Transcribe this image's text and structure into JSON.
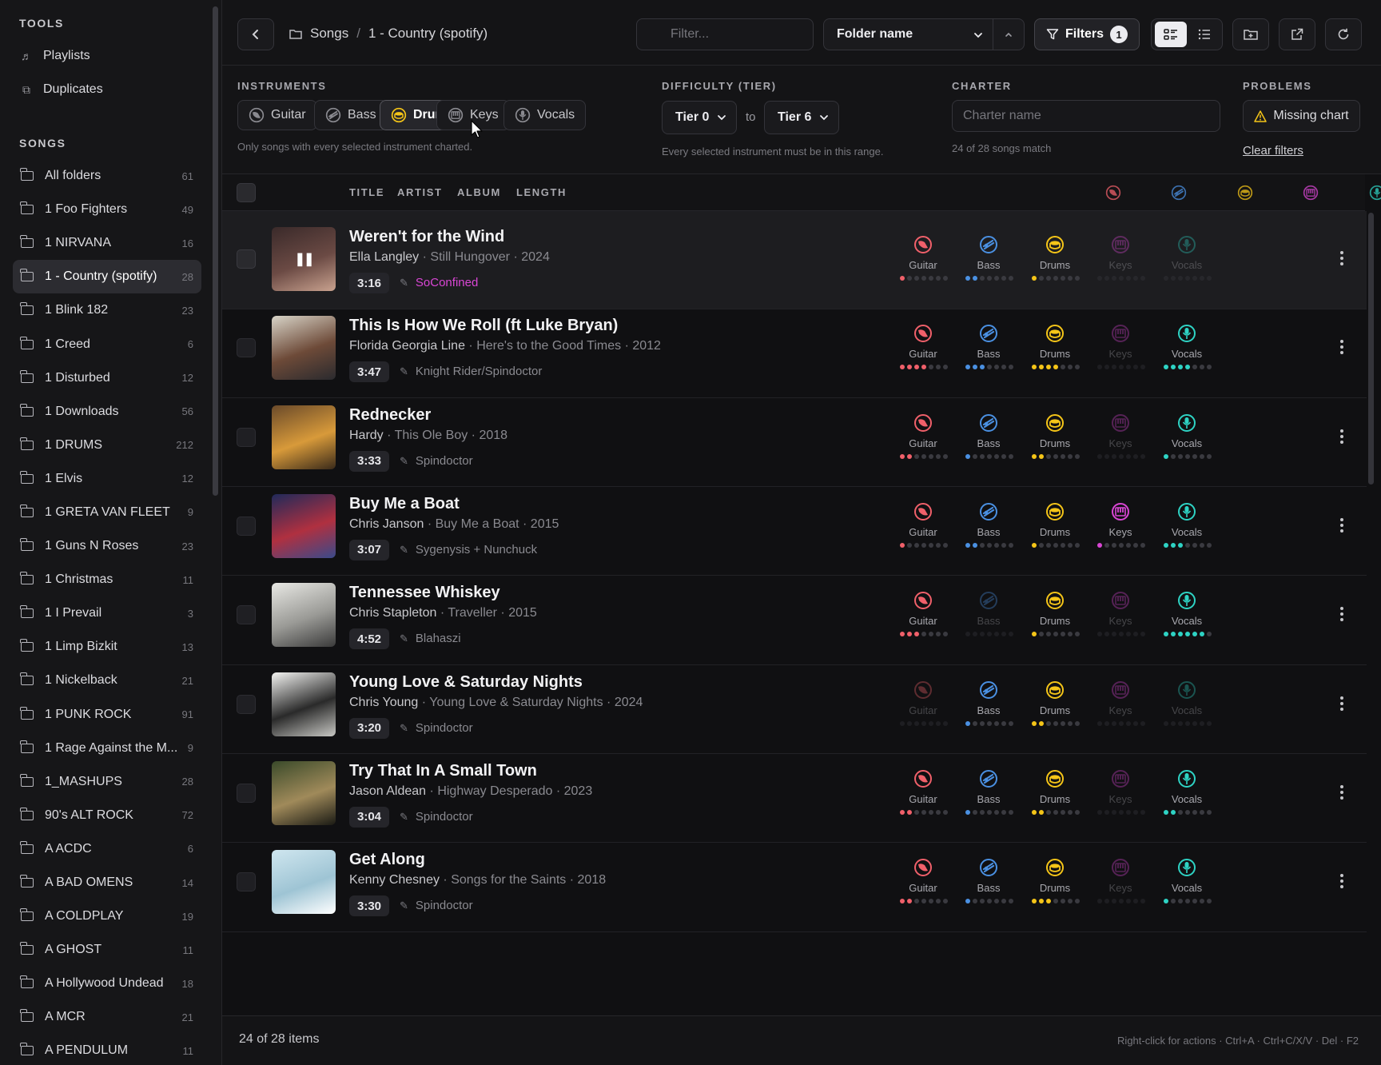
{
  "sidebar": {
    "tools_heading": "TOOLS",
    "tools": [
      {
        "label": "Playlists",
        "icon": "music-note-icon"
      },
      {
        "label": "Duplicates",
        "icon": "duplicate-icon"
      }
    ],
    "songs_heading": "SONGS",
    "folders": [
      {
        "name": "All folders",
        "count": "61"
      },
      {
        "name": "1 Foo Fighters",
        "count": "49"
      },
      {
        "name": "1 NIRVANA",
        "count": "16"
      },
      {
        "name": "1 - Country (spotify)",
        "count": "28",
        "active": true
      },
      {
        "name": "1 Blink 182",
        "count": "23"
      },
      {
        "name": "1 Creed",
        "count": "6"
      },
      {
        "name": "1 Disturbed",
        "count": "12"
      },
      {
        "name": "1 Downloads",
        "count": "56"
      },
      {
        "name": "1 DRUMS",
        "count": "212"
      },
      {
        "name": "1 Elvis",
        "count": "12"
      },
      {
        "name": "1 GRETA VAN FLEET",
        "count": "9"
      },
      {
        "name": "1 Guns N Roses",
        "count": "23"
      },
      {
        "name": "1 Christmas",
        "count": "11"
      },
      {
        "name": "1 I Prevail",
        "count": "3"
      },
      {
        "name": "1 Limp Bizkit",
        "count": "13"
      },
      {
        "name": "1 Nickelback",
        "count": "21"
      },
      {
        "name": "1 PUNK ROCK",
        "count": "91"
      },
      {
        "name": "1 Rage Against the M...",
        "count": "9"
      },
      {
        "name": "1_MASHUPS",
        "count": "28"
      },
      {
        "name": "90's ALT ROCK",
        "count": "72"
      },
      {
        "name": "A ACDC",
        "count": "6"
      },
      {
        "name": "A BAD OMENS",
        "count": "14"
      },
      {
        "name": "A COLDPLAY",
        "count": "19"
      },
      {
        "name": "A GHOST",
        "count": "11"
      },
      {
        "name": "A Hollywood Undead",
        "count": "18"
      },
      {
        "name": "A MCR",
        "count": "21"
      },
      {
        "name": "A PENDULUM",
        "count": "11"
      }
    ]
  },
  "toolbar": {
    "breadcrumb_root": "Songs",
    "breadcrumb_sep": "/",
    "breadcrumb_current": "1 - Country (spotify)",
    "filter_placeholder": "Filter...",
    "sort_label": "Folder name",
    "filters_label": "Filters",
    "filters_count": "1"
  },
  "filters": {
    "instruments_heading": "INSTRUMENTS",
    "instruments": [
      {
        "label": "Guitar",
        "selected": false
      },
      {
        "label": "Bass",
        "selected": false
      },
      {
        "label": "Drums",
        "selected": true
      },
      {
        "label": "Keys",
        "selected": false
      },
      {
        "label": "Vocals",
        "selected": false
      }
    ],
    "instruments_note": "Only songs with every selected instrument charted.",
    "difficulty_heading": "DIFFICULTY (TIER)",
    "tier_from": "Tier 0",
    "tier_to_word": "to",
    "tier_to": "Tier 6",
    "difficulty_note": "Every selected instrument must be in this range.",
    "charter_heading": "CHARTER",
    "charter_placeholder": "Charter name",
    "charter_note": "24 of 28 songs match",
    "problems_heading": "PROBLEMS",
    "missing_chart_label": "Missing chart",
    "clear_filters_label": "Clear filters"
  },
  "columns": {
    "title": "TITLE",
    "artist": "ARTIST",
    "album": "ALBUM",
    "length": "LENGTH"
  },
  "instrument_colors": {
    "Guitar": "#f0606a",
    "Bass": "#4a90e2",
    "Drums": "#f5c518",
    "Keys": "#d946d4",
    "Vocals": "#2ed3c4"
  },
  "songs": [
    {
      "title": "Weren't for the Wind",
      "artist": "Ella Langley",
      "album": "Still Hungover",
      "year": "2024",
      "length": "3:16",
      "charter": "SoConfined",
      "charter_color": "#d946d4",
      "playing": true,
      "tiers": {
        "Guitar": 1,
        "Bass": 2,
        "Drums": 1,
        "Keys": null,
        "Vocals": null
      }
    },
    {
      "title": "This Is How We Roll (ft Luke Bryan)",
      "artist": "Florida Georgia Line",
      "album": "Here's to the Good Times",
      "year": "2012",
      "length": "3:47",
      "charter": "Knight Rider/Spindoctor",
      "tiers": {
        "Guitar": 4,
        "Bass": 3,
        "Drums": 4,
        "Keys": null,
        "Vocals": 4
      }
    },
    {
      "title": "Rednecker",
      "artist": "Hardy",
      "album": "This Ole Boy",
      "year": "2018",
      "length": "3:33",
      "charter": "Spindoctor",
      "tiers": {
        "Guitar": 2,
        "Bass": 1,
        "Drums": 2,
        "Keys": null,
        "Vocals": 1
      }
    },
    {
      "title": "Buy Me a Boat",
      "artist": "Chris Janson",
      "album": "Buy Me a Boat",
      "year": "2015",
      "length": "3:07",
      "charter": "Sygenysis + Nunchuck",
      "tiers": {
        "Guitar": 1,
        "Bass": 2,
        "Drums": 1,
        "Keys": 1,
        "Vocals": 3
      }
    },
    {
      "title": "Tennessee Whiskey",
      "artist": "Chris Stapleton",
      "album": "Traveller",
      "year": "2015",
      "length": "4:52",
      "charter": "Blahaszi",
      "tiers": {
        "Guitar": 3,
        "Bass": null,
        "Drums": 1,
        "Keys": null,
        "Vocals": 6
      }
    },
    {
      "title": "Young Love & Saturday Nights",
      "artist": "Chris Young",
      "album": "Young Love & Saturday Nights",
      "year": "2024",
      "length": "3:20",
      "charter": "Spindoctor",
      "tiers": {
        "Guitar": null,
        "Bass": 1,
        "Drums": 2,
        "Keys": null,
        "Vocals": null
      }
    },
    {
      "title": "Try That In A Small Town",
      "artist": "Jason Aldean",
      "album": "Highway Desperado",
      "year": "2023",
      "length": "3:04",
      "charter": "Spindoctor",
      "tiers": {
        "Guitar": 2,
        "Bass": 1,
        "Drums": 2,
        "Keys": null,
        "Vocals": 2
      }
    },
    {
      "title": "Get Along",
      "artist": "Kenny Chesney",
      "album": "Songs for the Saints",
      "year": "2018",
      "length": "3:30",
      "charter": "Spindoctor",
      "tiers": {
        "Guitar": 2,
        "Bass": 1,
        "Drums": 3,
        "Keys": null,
        "Vocals": 1
      }
    }
  ],
  "status": {
    "count": "24 of 28 items",
    "hints": "Right-click for actions · Ctrl+A · Ctrl+C/X/V · Del · F2"
  }
}
